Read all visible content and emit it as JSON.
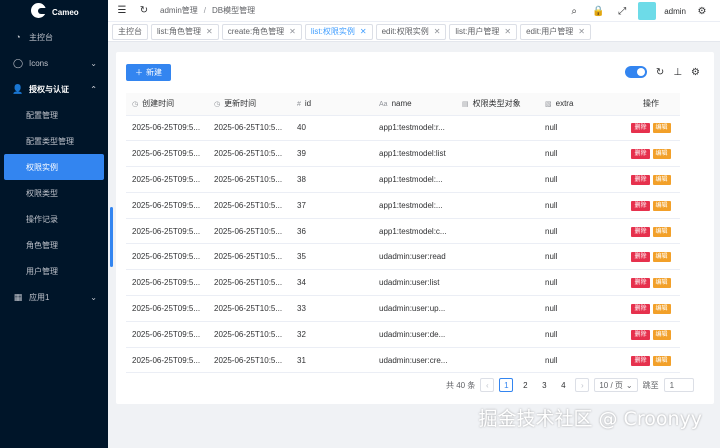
{
  "app": {
    "name": "Cameo"
  },
  "sidebar": {
    "items": [
      {
        "label": "主控台",
        "icon": "dashboard-icon"
      },
      {
        "label": "Icons",
        "icon": "circle-icon"
      },
      {
        "label": "授权与认证",
        "icon": "user-icon"
      }
    ],
    "sub_items": [
      "配置管理",
      "配置类型管理",
      "权限实例",
      "权限类型",
      "操作记录",
      "角色管理",
      "用户管理"
    ],
    "active_sub": "权限实例",
    "app1": {
      "label": "应用1",
      "icon": "grid-icon"
    }
  },
  "header": {
    "crumbs": [
      "admin管理",
      "/",
      "DB模型管理"
    ],
    "username": "admin"
  },
  "tabs": [
    {
      "label": "主控台",
      "closable": false
    },
    {
      "label": "list:角色管理",
      "closable": true
    },
    {
      "label": "create:角色管理",
      "closable": true
    },
    {
      "label": "list:权限实例",
      "closable": true,
      "active": true
    },
    {
      "label": "edit:权限实例",
      "closable": true
    },
    {
      "label": "list:用户管理",
      "closable": true
    },
    {
      "label": "edit:用户管理",
      "closable": true
    }
  ],
  "toolbar": {
    "new_label": "新建"
  },
  "table": {
    "columns": [
      "创建时间",
      "更新时间",
      "id",
      "name",
      "权限类型对象",
      "extra",
      "操作"
    ],
    "rows": [
      [
        "2025-06-25T09:5...",
        "2025-06-25T10:5...",
        "40",
        "app1:testmodel:r...",
        "",
        "null"
      ],
      [
        "2025-06-25T09:5...",
        "2025-06-25T10:5...",
        "39",
        "app1:testmodel:list",
        "",
        "null"
      ],
      [
        "2025-06-25T09:5...",
        "2025-06-25T10:5...",
        "38",
        "app1:testmodel:...",
        "",
        "null"
      ],
      [
        "2025-06-25T09:5...",
        "2025-06-25T10:5...",
        "37",
        "app1:testmodel:...",
        "",
        "null"
      ],
      [
        "2025-06-25T09:5...",
        "2025-06-25T10:5...",
        "36",
        "app1:testmodel:c...",
        "",
        "null"
      ],
      [
        "2025-06-25T09:5...",
        "2025-06-25T10:5...",
        "35",
        "udadmin:user:read",
        "",
        "null"
      ],
      [
        "2025-06-25T09:5...",
        "2025-06-25T10:5...",
        "34",
        "udadmin:user:list",
        "",
        "null"
      ],
      [
        "2025-06-25T09:5...",
        "2025-06-25T10:5...",
        "33",
        "udadmin:user:up...",
        "",
        "null"
      ],
      [
        "2025-06-25T09:5...",
        "2025-06-25T10:5...",
        "32",
        "udadmin:user:de...",
        "",
        "null"
      ],
      [
        "2025-06-25T09:5...",
        "2025-06-25T10:5...",
        "31",
        "udadmin:user:cre...",
        "",
        "null"
      ]
    ],
    "delete_label": "删除",
    "edit_label": "编辑"
  },
  "pagination": {
    "total_label": "共 40 条",
    "pages": [
      "1",
      "2",
      "3",
      "4"
    ],
    "current": "1",
    "page_size": "10 / 页",
    "jump_label": "跳至",
    "jump_value": "1"
  },
  "watermark": "掘金技术社区 @ Croonyy",
  "colors": {
    "sidebar_bg": "#001529",
    "primary": "#3385f0",
    "delete": "#e6314d",
    "edit": "#f2a029"
  }
}
